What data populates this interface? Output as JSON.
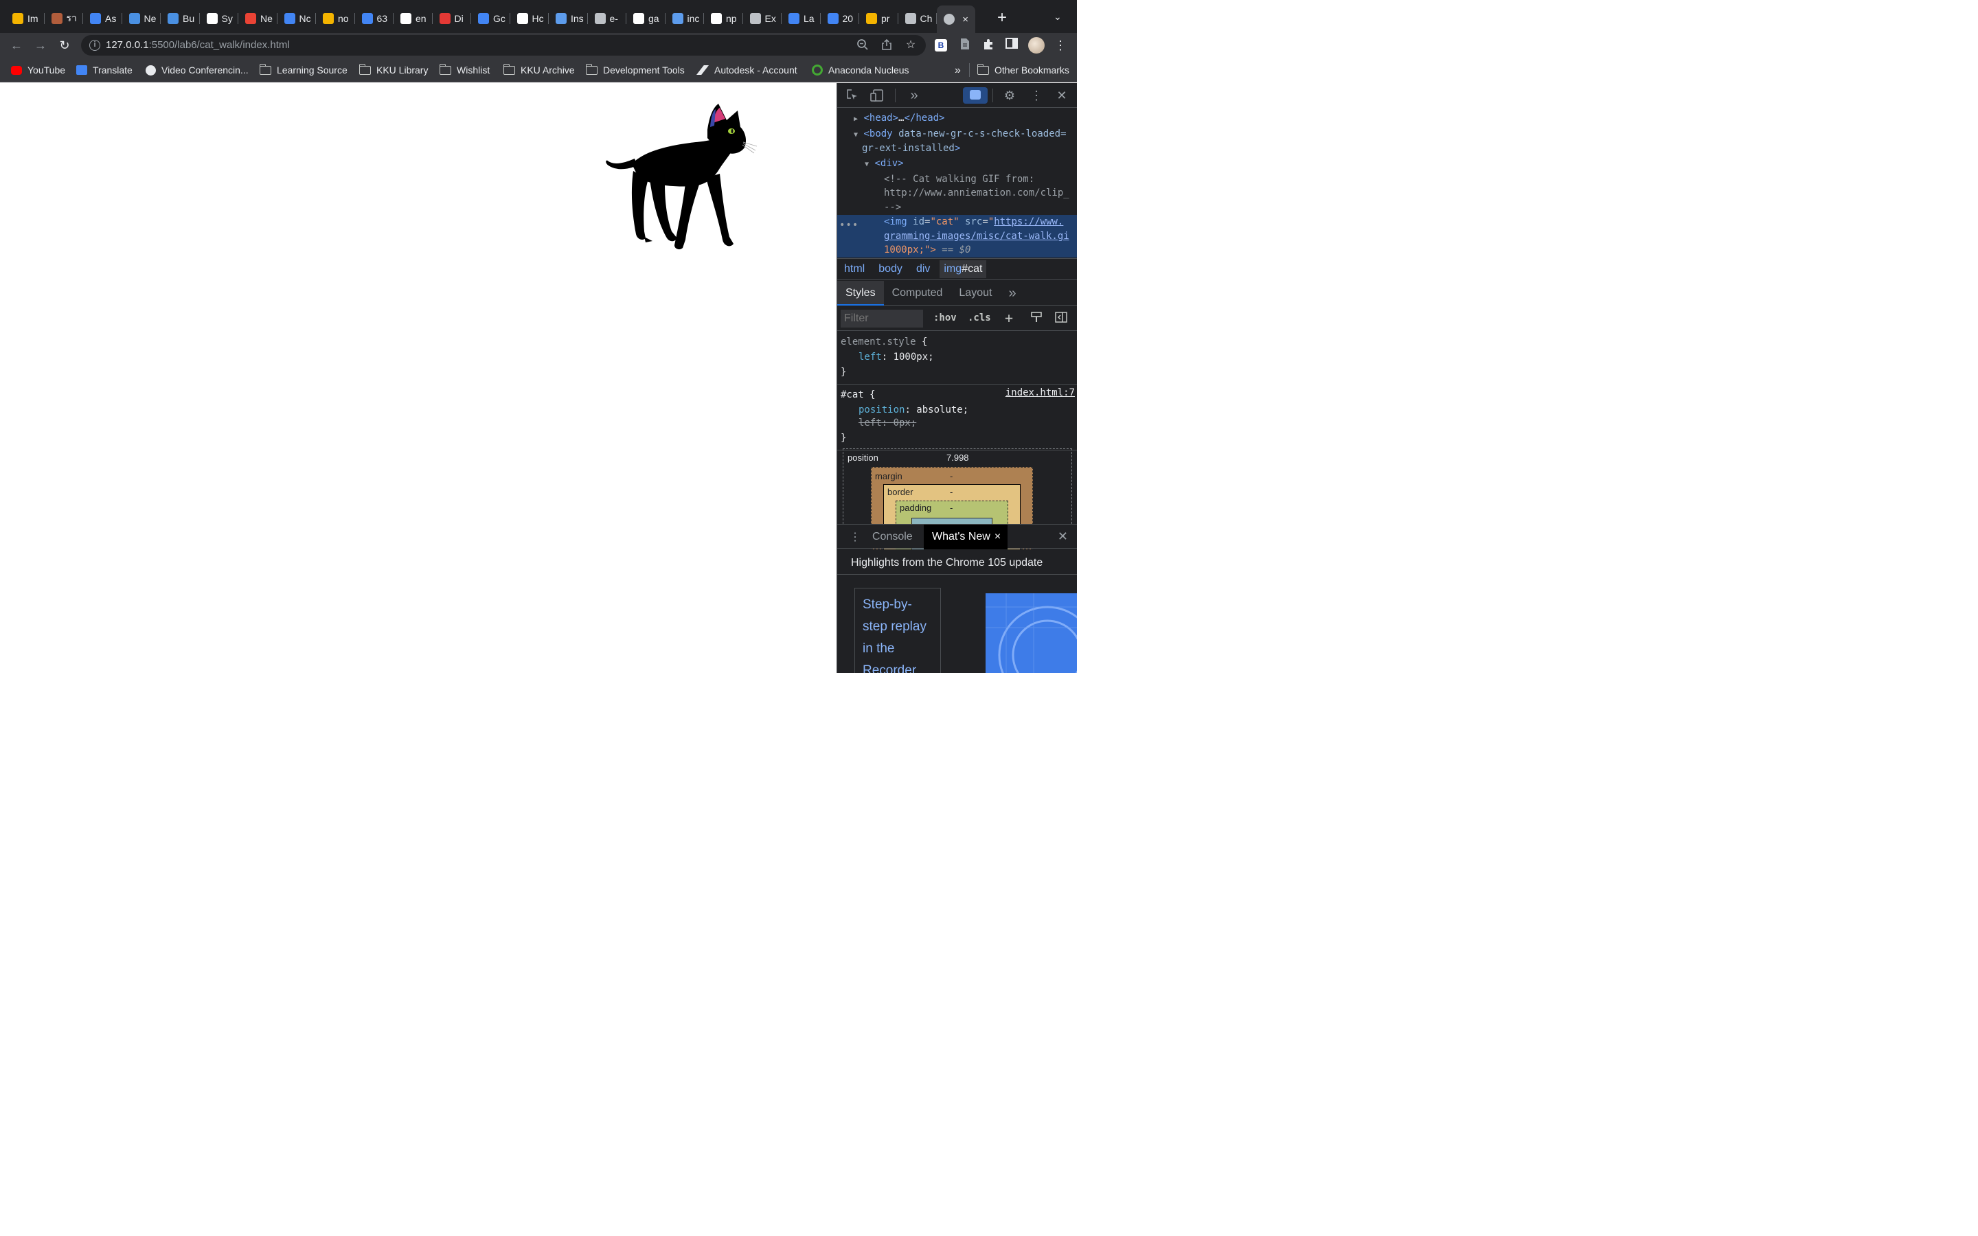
{
  "browser": {
    "tabs": [
      {
        "label": "Im",
        "icon": "google-drive-icon",
        "color": "#f4b400"
      },
      {
        "label": "รา",
        "icon": "pagoda-icon",
        "color": "#b15d3c"
      },
      {
        "label": "As",
        "icon": "google-classroom-icon",
        "color": "#4285f4"
      },
      {
        "label": "Ne",
        "icon": "globe-blue-icon",
        "color": "#4a90e2"
      },
      {
        "label": "Bu",
        "icon": "globe-blue-icon",
        "color": "#4a90e2"
      },
      {
        "label": "Sy",
        "icon": "wikipedia-icon",
        "color": "#ffffff"
      },
      {
        "label": "Ne",
        "icon": "gmail-icon",
        "color": "#ea4335"
      },
      {
        "label": "Nc",
        "icon": "google-classroom-icon",
        "color": "#4285f4"
      },
      {
        "label": "no",
        "icon": "google-slides-icon",
        "color": "#f4b400"
      },
      {
        "label": "63",
        "icon": "google-docs-icon",
        "color": "#4285f4"
      },
      {
        "label": "en",
        "icon": "google-icon",
        "color": "#ffffff"
      },
      {
        "label": "Di",
        "icon": "triangle-logo-icon",
        "color": "#e53935"
      },
      {
        "label": "Gc",
        "icon": "google-translate-icon",
        "color": "#4285f4"
      },
      {
        "label": "Hc",
        "icon": "medium-icon",
        "color": "#ffffff"
      },
      {
        "label": "Ins",
        "icon": "anaconda-snake-icon",
        "color": "#5d9cec"
      },
      {
        "label": "e-",
        "icon": "globe-icon",
        "color": "#bdc1c6"
      },
      {
        "label": "ga",
        "icon": "google-icon",
        "color": "#ffffff"
      },
      {
        "label": "inc",
        "icon": "anaconda-snake-icon",
        "color": "#5d9cec"
      },
      {
        "label": "np",
        "icon": "google-icon",
        "color": "#ffffff"
      },
      {
        "label": "Ex",
        "icon": "book-icon",
        "color": "#bdc1c6"
      },
      {
        "label": "La",
        "icon": "google-classroom-icon",
        "color": "#4285f4"
      },
      {
        "label": "20",
        "icon": "google-docs-icon",
        "color": "#4285f4"
      },
      {
        "label": "pr",
        "icon": "google-drive-icon",
        "color": "#f4b400"
      },
      {
        "label": "Ch",
        "icon": "globe-icon",
        "color": "#bdc1c6"
      }
    ],
    "active_tab_icon": "globe-icon",
    "new_tab": "+",
    "url_host": "127.0.0.1",
    "url_rest": ":5500/lab6/cat_walk/index.html",
    "bookmarks": [
      {
        "label": "YouTube",
        "icon": "youtube-icon"
      },
      {
        "label": "Translate",
        "icon": "google-translate-icon"
      },
      {
        "label": "Video Conferencin...",
        "icon": "globe-icon"
      },
      {
        "label": "Learning Source",
        "icon": "folder-icon"
      },
      {
        "label": "KKU Library",
        "icon": "folder-icon"
      },
      {
        "label": "Wishlist",
        "icon": "folder-icon"
      },
      {
        "label": "KKU Archive",
        "icon": "folder-icon"
      },
      {
        "label": "Development Tools",
        "icon": "folder-icon"
      },
      {
        "label": "Autodesk - Account",
        "icon": "autodesk-icon"
      },
      {
        "label": "Anaconda Nucleus",
        "icon": "anaconda-ring-icon"
      }
    ],
    "bookmarks_overflow": "»",
    "other_bookmarks": "Other Bookmarks"
  },
  "page": {
    "image": "cat-walk-image"
  },
  "devtools": {
    "elements": {
      "head": "<head>",
      "head_ellipsis": "…",
      "head_close": "</head>",
      "body_open": "<body",
      "body_attr1": "data-new-gr-c-s-check-loaded=",
      "body_attr2": "gr-ext-installed",
      "body_close_bracket": ">",
      "div_open": "<div>",
      "comment1": "<!-- Cat walking GIF from:",
      "comment2": "http://www.anniemation.com/clip_",
      "comment3": "-->",
      "img_tag": "<img",
      "img_id_attr": "id",
      "img_id_val": "\"cat\"",
      "img_src_attr": "src",
      "img_src_val1": "https://www.",
      "img_src_val2": "gramming-images/misc/cat-walk.gi",
      "img_style_tail": "1000px;\">",
      "img_eq": "== $0",
      "more_dots": "•••"
    },
    "breadcrumbs": [
      "html",
      "body",
      "div"
    ],
    "breadcrumb_current_tag": "img",
    "breadcrumb_current_id": "#cat",
    "tabs": [
      "Styles",
      "Computed",
      "Layout"
    ],
    "tabs_more": "»",
    "filter_placeholder": "Filter",
    "hov": ":hov",
    "cls": ".cls",
    "rules": {
      "element_style_selector": "element.style",
      "element_style_prop": "left",
      "element_style_value": "1000px;",
      "cat_selector": "#cat",
      "cat_source": "index.html:7",
      "cat_prop1": "position",
      "cat_val1": "absolute;",
      "cat_prop2": "left",
      "cat_val2": "0px;",
      "open_brace": "{",
      "close_brace": "}"
    },
    "box_model": {
      "position_label": "position",
      "position_value": "7.998",
      "margin_label": "margin",
      "margin_value": "-",
      "border_label": "border",
      "border_value": "-",
      "padding_label": "padding",
      "padding_value": "-"
    },
    "drawer": {
      "console": "Console",
      "whats_new": "What's New",
      "close_x": "×",
      "highlights": "Highlights from the Chrome 105 update",
      "card_text": "Step-by-step replay in the Recorder"
    }
  }
}
